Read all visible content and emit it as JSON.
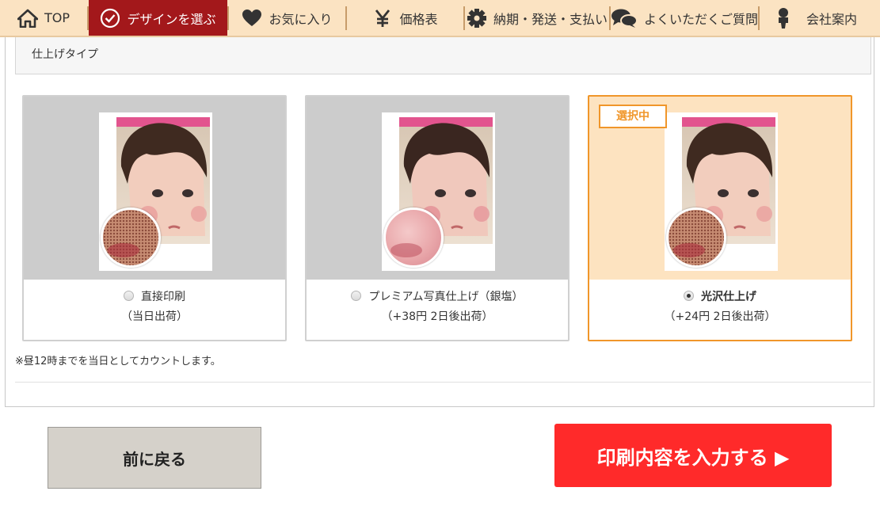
{
  "nav": {
    "items": [
      {
        "label": "TOP",
        "icon": "home-icon"
      },
      {
        "label": "デザインを選ぶ",
        "icon": "check-circle-icon"
      },
      {
        "label": "お気に入り",
        "icon": "heart-icon"
      },
      {
        "label": "価格表",
        "icon": "yen-icon"
      },
      {
        "label": "納期・発送・支払い",
        "icon": "gear-icon"
      },
      {
        "label": "よくいただくご質問",
        "icon": "chat-bubbles-icon"
      },
      {
        "label": "会社案内",
        "icon": "person-icon"
      }
    ],
    "active_index": 1
  },
  "section": {
    "title": "仕上げタイプ"
  },
  "options": [
    {
      "label": "直接印刷",
      "sub": "（当日出荷）",
      "selected": false,
      "loupe": "dots"
    },
    {
      "label": "プレミアム写真仕上げ（銀塩）",
      "sub": "（+38円 2日後出荷）",
      "selected": false,
      "loupe": "smooth"
    },
    {
      "label": "光沢仕上げ",
      "sub": "（+24円 2日後出荷）",
      "selected": true,
      "loupe": "dots",
      "badge": "選択中"
    }
  ],
  "note": "※昼12時までを当日としてカウントします。",
  "buttons": {
    "back": "前に戻る",
    "next": "印刷内容を入力する ▶"
  },
  "colors": {
    "nav_bg": "#fbe3c2",
    "nav_active": "#a3181b",
    "selected_accent": "#f0962a",
    "next_button": "#ff2a2a"
  }
}
